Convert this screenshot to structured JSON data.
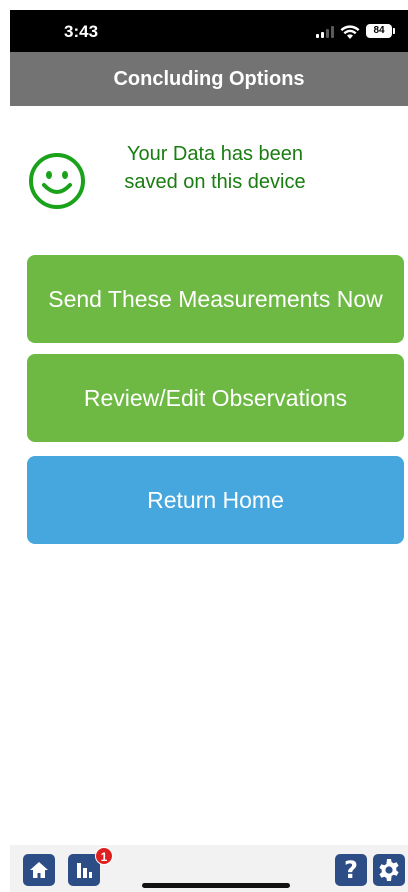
{
  "status_bar": {
    "time": "3:43",
    "battery": "84"
  },
  "header": {
    "title": "Concluding Options"
  },
  "notice": {
    "icon": "smiley-icon",
    "message": "Your Data has been saved on this device",
    "color": "#1a7d12"
  },
  "buttons": {
    "send": "Send These Measurements Now",
    "review": "Review/Edit Observations",
    "home": "Return Home"
  },
  "colors": {
    "green_button": "#6db944",
    "blue_button": "#45a7dd",
    "header": "#737373",
    "tab_icon": "#2c4d86"
  },
  "bottom_bar": {
    "home_icon": "home-icon",
    "stats_icon": "bar-chart-icon",
    "stats_badge": "1",
    "help_label": "?",
    "settings_icon": "gear-icon"
  }
}
